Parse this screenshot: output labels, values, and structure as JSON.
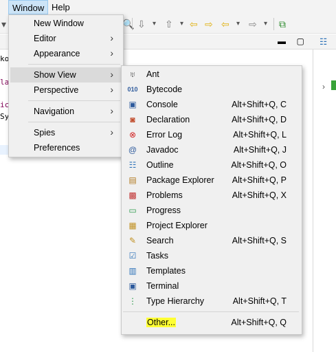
{
  "menubar": {
    "window": "Window",
    "help": "Help"
  },
  "editor": {
    "code_fragments": [
      "ko",
      "la",
      "ic",
      "Sy"
    ]
  },
  "window_menu": {
    "items": [
      {
        "label": "New Window"
      },
      {
        "label": "Editor"
      },
      {
        "label": "Appearance"
      },
      {
        "label": "Show View"
      },
      {
        "label": "Perspective"
      },
      {
        "label": "Navigation"
      },
      {
        "label": "Spies"
      },
      {
        "label": "Preferences"
      }
    ],
    "selected": "Show View"
  },
  "show_view_menu": {
    "items": [
      {
        "label": "Ant",
        "shortcut": "",
        "icon": "ant-icon"
      },
      {
        "label": "Bytecode",
        "shortcut": "",
        "icon": "bytecode-icon"
      },
      {
        "label": "Console",
        "shortcut": "Alt+Shift+Q, C",
        "icon": "console-icon"
      },
      {
        "label": "Declaration",
        "shortcut": "Alt+Shift+Q, D",
        "icon": "declaration-icon"
      },
      {
        "label": "Error Log",
        "shortcut": "Alt+Shift+Q, L",
        "icon": "error-log-icon"
      },
      {
        "label": "Javadoc",
        "shortcut": "Alt+Shift+Q, J",
        "icon": "javadoc-icon"
      },
      {
        "label": "Outline",
        "shortcut": "Alt+Shift+Q, O",
        "icon": "outline-icon"
      },
      {
        "label": "Package Explorer",
        "shortcut": "Alt+Shift+Q, P",
        "icon": "package-explorer-icon"
      },
      {
        "label": "Problems",
        "shortcut": "Alt+Shift+Q, X",
        "icon": "problems-icon"
      },
      {
        "label": "Progress",
        "shortcut": "",
        "icon": "progress-icon"
      },
      {
        "label": "Project Explorer",
        "shortcut": "",
        "icon": "project-explorer-icon"
      },
      {
        "label": "Search",
        "shortcut": "Alt+Shift+Q, S",
        "icon": "search-icon"
      },
      {
        "label": "Tasks",
        "shortcut": "",
        "icon": "tasks-icon"
      },
      {
        "label": "Templates",
        "shortcut": "",
        "icon": "templates-icon"
      },
      {
        "label": "Terminal",
        "shortcut": "",
        "icon": "terminal-icon"
      },
      {
        "label": "Type Hierarchy",
        "shortcut": "Alt+Shift+Q, T",
        "icon": "type-hierarchy-icon"
      }
    ],
    "other": {
      "label": "Other...",
      "shortcut": "Alt+Shift+Q, Q"
    }
  },
  "colors": {
    "menu_bg": "#f0f0f0",
    "selected_bg": "#dadada",
    "highlight": "#ffff33",
    "menubar_active": "#cce4f7"
  }
}
